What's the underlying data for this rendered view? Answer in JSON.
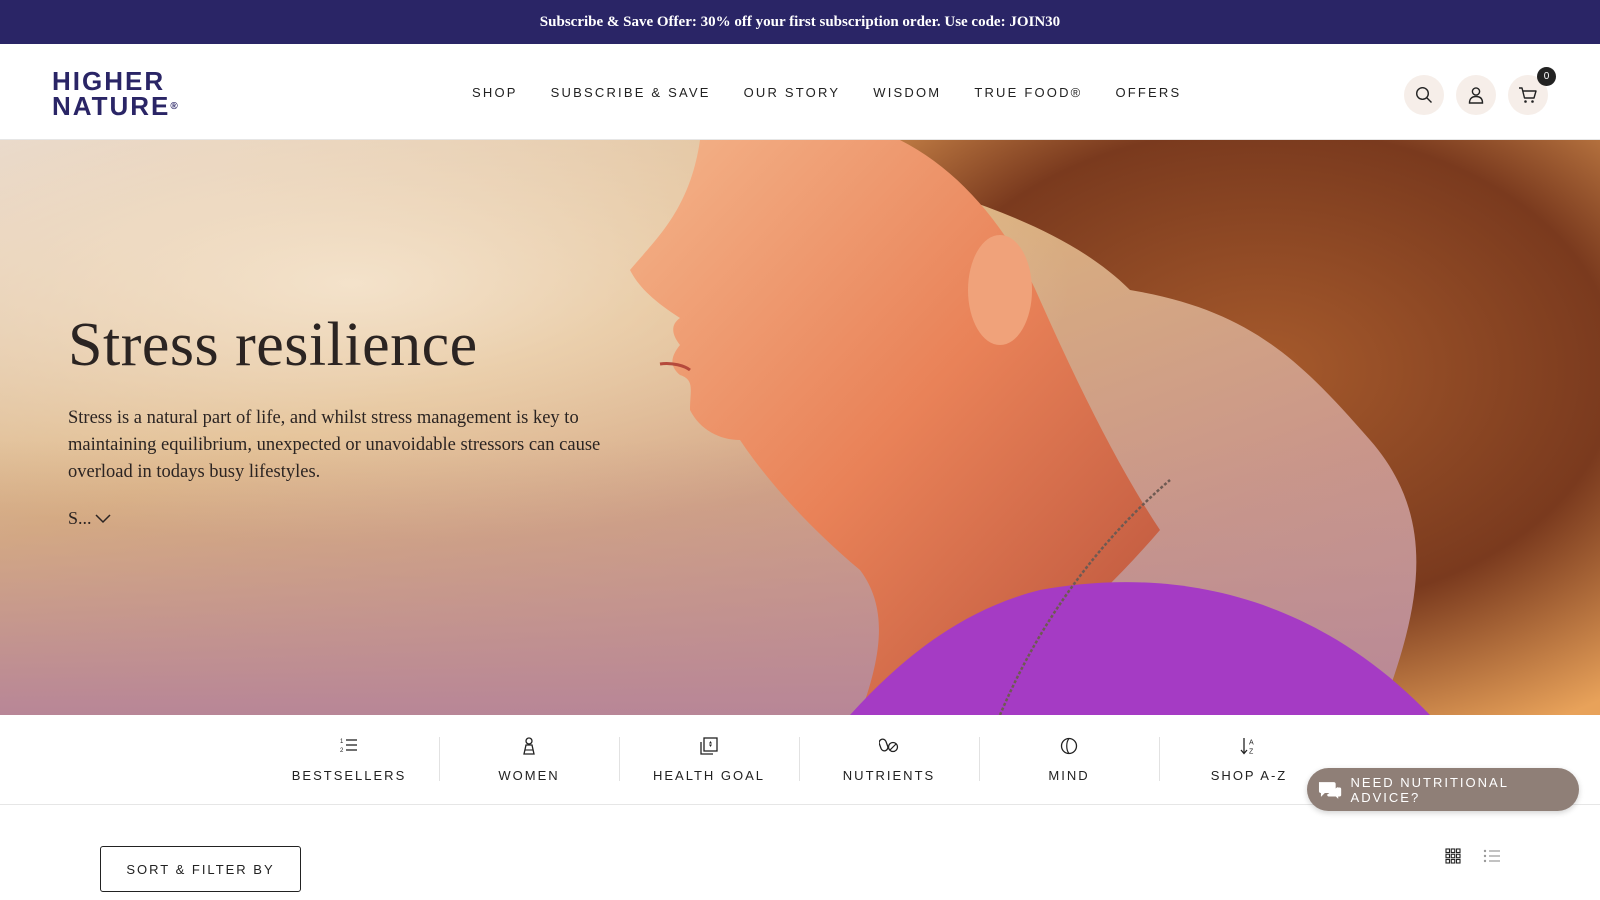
{
  "promo": {
    "text": "Subscribe & Save Offer: 30% off your first subscription order. Use code: JOIN30"
  },
  "brand": {
    "line1": "HIGHER",
    "line2": "NATURE",
    "mark": "®"
  },
  "nav": {
    "items": [
      "SHOP",
      "SUBSCRIBE & SAVE",
      "OUR STORY",
      "WISDOM",
      "TRUE FOOD®",
      "OFFERS"
    ]
  },
  "header_icons": {
    "search": "search-icon",
    "account": "user-icon",
    "cart": "cart-icon",
    "cart_count": "0"
  },
  "hero": {
    "title": "Stress resilience",
    "text": "Stress is a natural part of life, and whilst stress management is key to maintaining equilibrium, unexpected or unavoidable stressors can cause overload in todays busy lifestyles.",
    "more_label": "S..."
  },
  "categories": [
    {
      "label": "BESTSELLERS",
      "icon": "list-ranking-icon"
    },
    {
      "label": "WOMEN",
      "icon": "woman-icon"
    },
    {
      "label": "HEALTH GOAL",
      "icon": "health-goal-icon"
    },
    {
      "label": "NUTRIENTS",
      "icon": "capsules-icon"
    },
    {
      "label": "MIND",
      "icon": "mind-icon"
    },
    {
      "label": "SHOP A-Z",
      "icon": "sort-az-icon"
    }
  ],
  "advice": {
    "label": "NEED NUTRITIONAL ADVICE?"
  },
  "toolbar": {
    "sort_filter_label": "SORT & FILTER BY"
  },
  "colors": {
    "promo_bg": "#2a2566",
    "brand": "#2a2566",
    "advice_bg": "#8f7f77",
    "icon_bg": "#f6eee9"
  }
}
